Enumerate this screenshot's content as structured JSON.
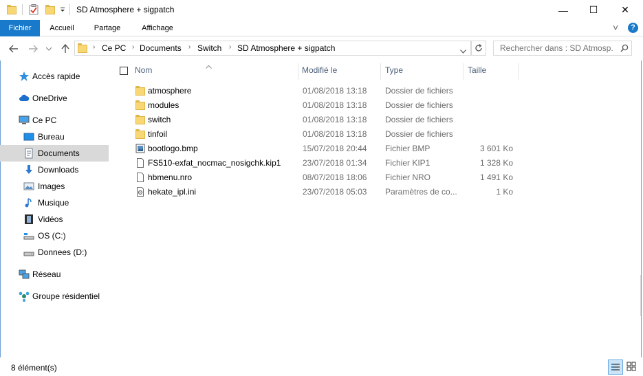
{
  "window": {
    "title": "SD Atmosphere + sigpatch",
    "minimize": "—",
    "maximize": "☐",
    "close": "✕"
  },
  "ribbon": {
    "tabs": [
      "Fichier",
      "Accueil",
      "Partage",
      "Affichage"
    ],
    "expand": "˅",
    "help": "?"
  },
  "address": {
    "path": [
      "Ce PC",
      "Documents",
      "Switch",
      "SD Atmosphere + sigpatch"
    ],
    "search_placeholder": "Rechercher dans : SD Atmosp..."
  },
  "nav_pane": {
    "items": [
      {
        "label": "Accès rapide",
        "icon": "star-icon"
      },
      {
        "label": "OneDrive",
        "icon": "cloud-icon"
      },
      {
        "label": "Ce PC",
        "icon": "computer-icon"
      },
      {
        "label": "Bureau",
        "icon": "desktop-icon"
      },
      {
        "label": "Documents",
        "icon": "documents-icon"
      },
      {
        "label": "Downloads",
        "icon": "download-icon"
      },
      {
        "label": "Images",
        "icon": "images-icon"
      },
      {
        "label": "Musique",
        "icon": "music-icon"
      },
      {
        "label": "Vidéos",
        "icon": "video-icon"
      },
      {
        "label": "OS (C:)",
        "icon": "drive-os-icon"
      },
      {
        "label": "Donnees (D:)",
        "icon": "drive-icon"
      },
      {
        "label": "Réseau",
        "icon": "network-icon"
      },
      {
        "label": "Groupe résidentiel",
        "icon": "homegroup-icon"
      }
    ],
    "selected": "Documents"
  },
  "columns": {
    "name": "Nom",
    "modified": "Modifié le",
    "type": "Type",
    "size": "Taille"
  },
  "files": [
    {
      "name": "atmosphere",
      "modified": "01/08/2018 13:18",
      "type": "Dossier de fichiers",
      "size": "",
      "icon": "folder-icon"
    },
    {
      "name": "modules",
      "modified": "01/08/2018 13:18",
      "type": "Dossier de fichiers",
      "size": "",
      "icon": "folder-icon"
    },
    {
      "name": "switch",
      "modified": "01/08/2018 13:18",
      "type": "Dossier de fichiers",
      "size": "",
      "icon": "folder-icon"
    },
    {
      "name": "tinfoil",
      "modified": "01/08/2018 13:18",
      "type": "Dossier de fichiers",
      "size": "",
      "icon": "folder-icon"
    },
    {
      "name": "bootlogo.bmp",
      "modified": "15/07/2018 20:44",
      "type": "Fichier BMP",
      "size": "3 601 Ko",
      "icon": "image-file-icon"
    },
    {
      "name": "FS510-exfat_nocmac_nosigchk.kip1",
      "modified": "23/07/2018 01:34",
      "type": "Fichier KIP1",
      "size": "1 328 Ko",
      "icon": "file-icon"
    },
    {
      "name": "hbmenu.nro",
      "modified": "08/07/2018 18:06",
      "type": "Fichier NRO",
      "size": "1 491 Ko",
      "icon": "file-icon"
    },
    {
      "name": "hekate_ipl.ini",
      "modified": "23/07/2018 05:03",
      "type": "Paramètres de co...",
      "size": "1 Ko",
      "icon": "settings-file-icon"
    }
  ],
  "status": {
    "count": "8 élément(s)"
  },
  "colors": {
    "accent": "#1979ca",
    "folder": "#f8d775",
    "selected_nav": "#d9d9d9"
  }
}
